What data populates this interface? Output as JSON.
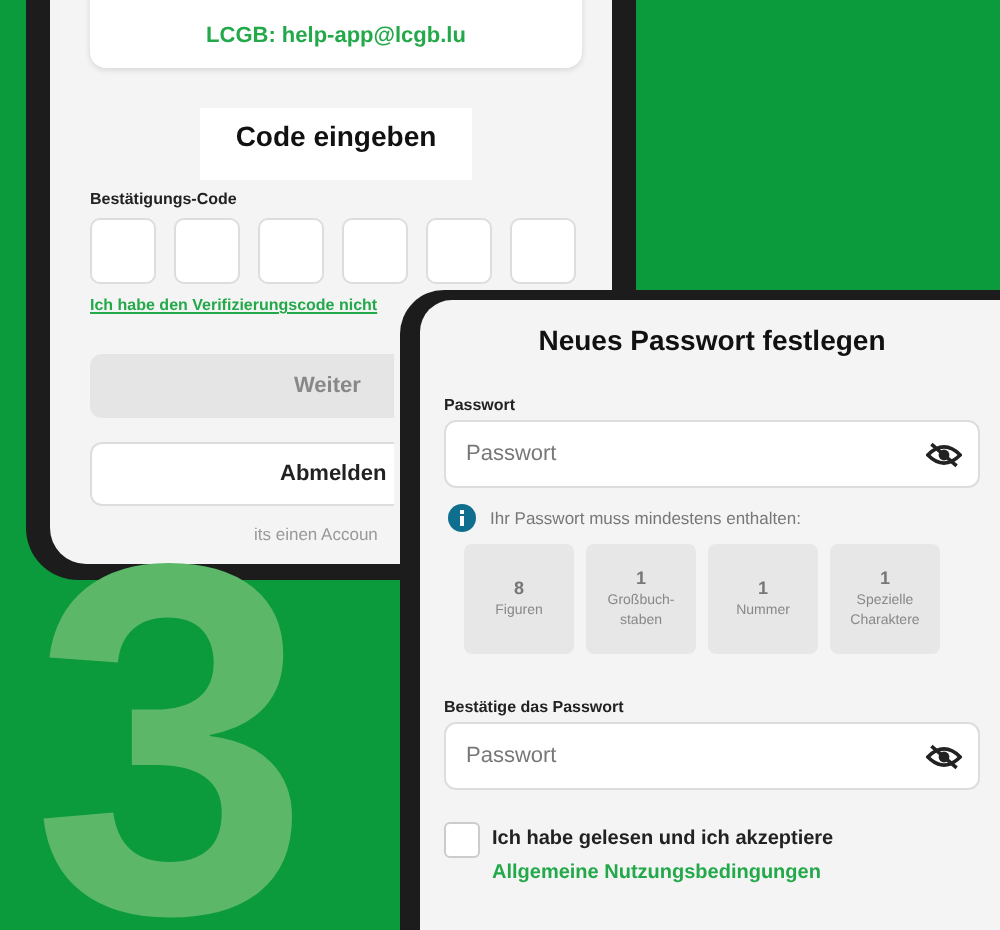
{
  "step_number": "3",
  "phone_1": {
    "support_contact": "LCGB: help-app@lcgb.lu",
    "title": "Code eingeben",
    "code_label": "Bestätigungs-Code",
    "code_boxes": [
      {
        "kind": "digit"
      },
      {
        "kind": "digit"
      },
      {
        "kind": "digit"
      },
      {
        "kind": "digit"
      },
      {
        "kind": "digit"
      },
      {
        "kind": "digit"
      }
    ],
    "resend_link": "Ich habe den Verifizierungscode nicht",
    "buttons": [
      {
        "label": "Weiter",
        "disabled": true
      },
      {
        "label": "Abmelden",
        "disabled": false
      }
    ],
    "account_hint": "its einen Accoun"
  },
  "phone_2": {
    "title": "Neues Passwort festlegen",
    "password_field": {
      "label": "Passwort",
      "placeholder": "Passwort"
    },
    "hint": "Ihr Passwort muss mindestens enthalten:",
    "requirements": [
      {
        "count": "8",
        "label": "Figuren"
      },
      {
        "count": "1",
        "label": "Großbuch-\nstaben"
      },
      {
        "count": "1",
        "label": "Nummer"
      },
      {
        "count": "1",
        "label": "Spezielle\nCharaktere"
      }
    ],
    "confirm_field": {
      "label": "Bestätige das Passwort",
      "placeholder": "Passwort"
    },
    "terms": {
      "checked": false,
      "text": "Ich habe gelesen und ich akzeptiere",
      "link": "Allgemeine Nutzungsbedingungen"
    }
  }
}
